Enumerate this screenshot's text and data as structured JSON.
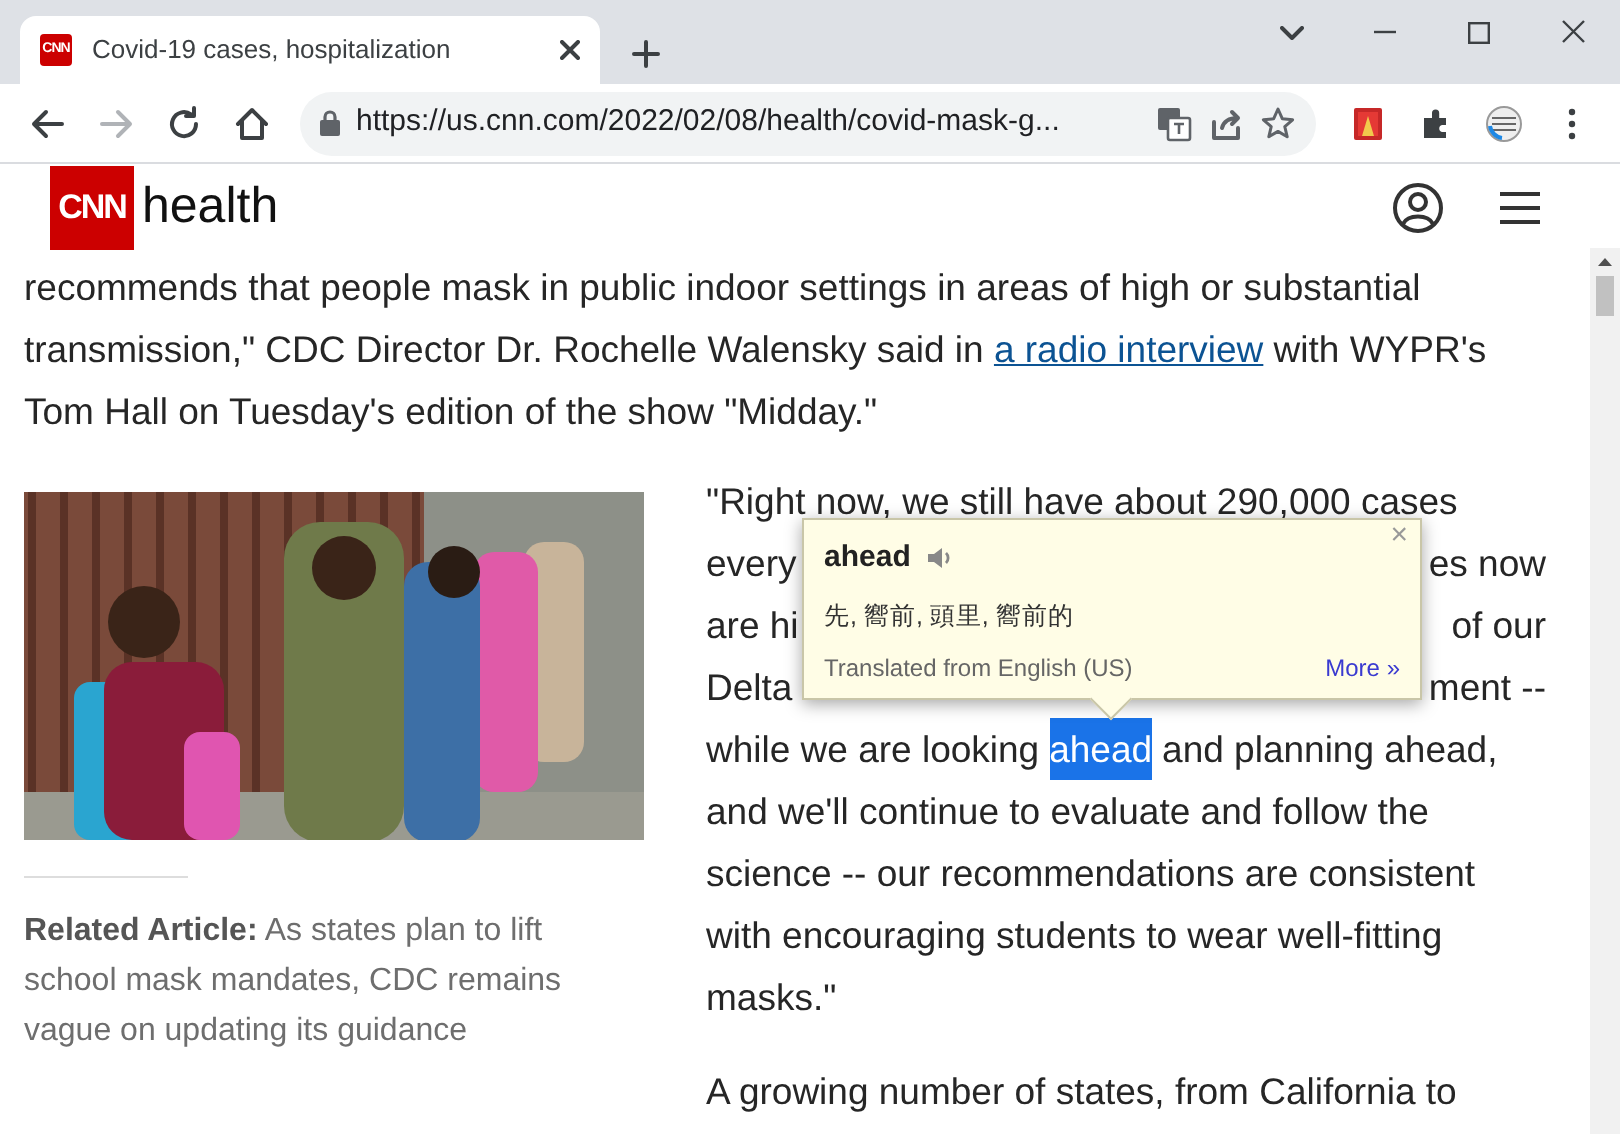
{
  "browser": {
    "tabs": [
      {
        "title": "Covid-19 cases, hospitalization",
        "favicon": "CNN",
        "selected": true
      }
    ],
    "nav": [
      {
        "kind": "back",
        "disabled": false
      },
      {
        "kind": "forward",
        "disabled": true
      },
      {
        "kind": "reload",
        "disabled": false
      },
      {
        "kind": "home",
        "disabled": false
      }
    ],
    "url": "https://us.cnn.com/2022/02/08/health/covid-mask-g..."
  },
  "site_header": {
    "logo": "CNN",
    "section": "health"
  },
  "intro_paragraph": {
    "before": "recommends that people mask in public indoor settings in areas of high or substantial\ntransmission,\" CDC Director Dr. Rochelle Walensky said in",
    "link": "a radio interview",
    "after": "with WYPR's\nTom Hall on Tuesday's edition of the show \"Midday.\""
  },
  "related": {
    "label": "Related Article:",
    "text": "As states plan to lift\nschool mask mandates, CDC remains\nvague on updating its guidance"
  },
  "quote_lines": [
    {
      "parts": [
        {
          "text": "\"Right now, we still have about 290,000 cases",
          "highlighted": false
        }
      ]
    },
    {
      "parts": [
        {
          "text": "every",
          "highlighted": false
        },
        {
          "text": "es now",
          "highlighted": false
        }
      ]
    },
    {
      "parts": [
        {
          "text": "are hi",
          "highlighted": false
        },
        {
          "text": "of our",
          "highlighted": false
        }
      ]
    },
    {
      "parts": [
        {
          "text": "Delta",
          "highlighted": false
        },
        {
          "text": "ment --",
          "highlighted": false
        }
      ]
    },
    {
      "parts": [
        {
          "text": "while we are looking",
          "highlighted": false
        },
        {
          "text": "ahead",
          "highlighted": true
        },
        {
          "text": "and planning ahead,",
          "highlighted": false
        }
      ]
    }
  ],
  "quote_rest": "and we'll continue to evaluate and follow the\nscience -- our recommendations are consistent\nwith encouraging students to wear well-fitting\nmasks.\"",
  "next_paragraph": "A growing number of states, from California to",
  "translate_popup": {
    "word": "ahead",
    "close": "×",
    "translation": "先, 嚮前, 頭里, 嚮前的",
    "source": "Translated from English (US)",
    "more": "More »"
  }
}
